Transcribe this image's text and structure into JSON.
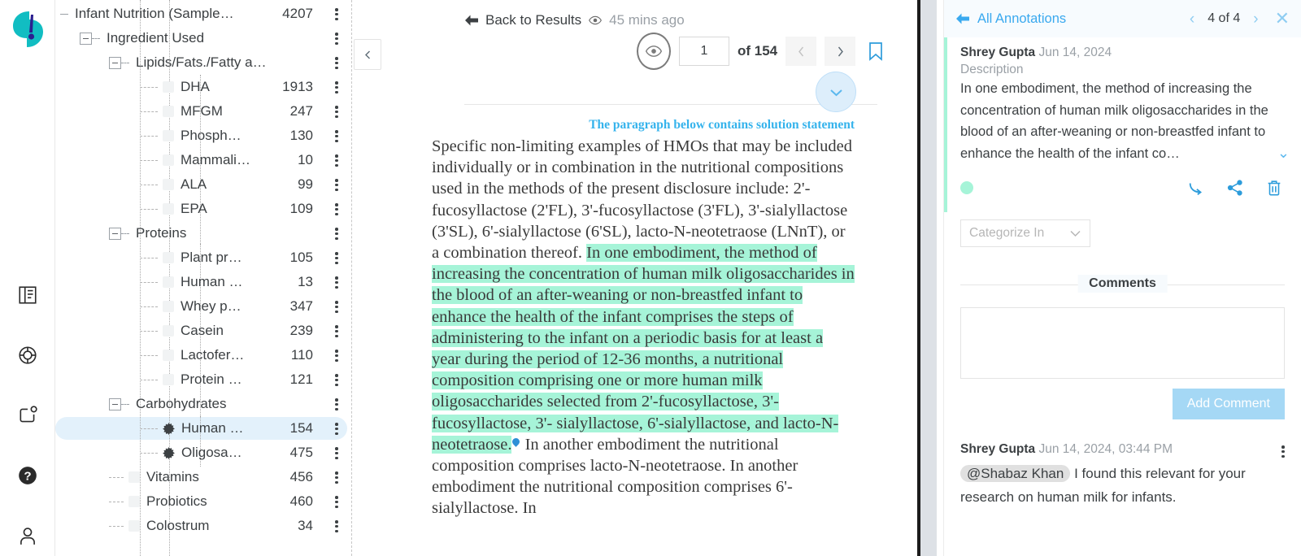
{
  "brand": {
    "logo_name": "app-logo",
    "teal": "#11bdc2",
    "navy": "#2b1f8f"
  },
  "rail": {
    "items": [
      {
        "name": "library-icon",
        "label": "Library"
      },
      {
        "name": "target-icon",
        "label": "Insights"
      },
      {
        "name": "notifications-icon",
        "label": "Alerts"
      },
      {
        "name": "help-icon",
        "label": "Help"
      },
      {
        "name": "user-icon",
        "label": "Account"
      }
    ]
  },
  "tree": {
    "rows": [
      {
        "label": "Infant Nutrition (Sample…",
        "count": "4207",
        "depth": 0,
        "type": "root",
        "expanded": true,
        "selected": false
      },
      {
        "label": "Ingredient Used",
        "count": "",
        "depth": 1,
        "type": "branch",
        "expanded": true,
        "selected": false
      },
      {
        "label": "Lipids/Fats./Fatty a…",
        "count": "",
        "depth": 2,
        "type": "branch",
        "expanded": true,
        "selected": false
      },
      {
        "label": "DHA",
        "count": "1913",
        "depth": 3,
        "type": "leaf",
        "selected": false
      },
      {
        "label": "MFGM",
        "count": "247",
        "depth": 3,
        "type": "leaf",
        "selected": false
      },
      {
        "label": "Phosph…",
        "count": "130",
        "depth": 3,
        "type": "leaf",
        "selected": false
      },
      {
        "label": "Mammali…",
        "count": "10",
        "depth": 3,
        "type": "leaf",
        "selected": false
      },
      {
        "label": "ALA",
        "count": "99",
        "depth": 3,
        "type": "leaf",
        "selected": false
      },
      {
        "label": "EPA",
        "count": "109",
        "depth": 3,
        "type": "leaf",
        "selected": false
      },
      {
        "label": "Proteins",
        "count": "",
        "depth": 2,
        "type": "branch",
        "expanded": true,
        "selected": false
      },
      {
        "label": "Plant pr…",
        "count": "105",
        "depth": 3,
        "type": "leaf",
        "selected": false
      },
      {
        "label": "Human …",
        "count": "13",
        "depth": 3,
        "type": "leaf",
        "selected": false
      },
      {
        "label": "Whey p…",
        "count": "347",
        "depth": 3,
        "type": "leaf",
        "selected": false
      },
      {
        "label": "Casein",
        "count": "239",
        "depth": 3,
        "type": "leaf",
        "selected": false
      },
      {
        "label": "Lactofer…",
        "count": "110",
        "depth": 3,
        "type": "leaf",
        "selected": false
      },
      {
        "label": "Protein …",
        "count": "121",
        "depth": 3,
        "type": "leaf",
        "selected": false
      },
      {
        "label": "Carbohydrates",
        "count": "",
        "depth": 2,
        "type": "branch",
        "expanded": true,
        "selected": false
      },
      {
        "label": "Human …",
        "count": "154",
        "depth": 3,
        "type": "burst",
        "selected": true
      },
      {
        "label": "Oligosa…",
        "count": "475",
        "depth": 3,
        "type": "burst",
        "selected": false
      },
      {
        "label": "Vitamins",
        "count": "456",
        "depth": 2,
        "type": "leaf2",
        "selected": false
      },
      {
        "label": "Probiotics",
        "count": "460",
        "depth": 2,
        "type": "leaf2",
        "selected": false
      },
      {
        "label": "Colostrum",
        "count": "34",
        "depth": 2,
        "type": "leaf2",
        "selected": false
      }
    ]
  },
  "doc": {
    "back_label": "Back to Results",
    "viewed_ago": "45 mins ago",
    "page_value": "1",
    "page_total": "of 154",
    "solution_note": "The paragraph below contains solution statement",
    "para_pre": "Specific non-limiting examples of HMOs that may be included individually or in combination in the nutritional compositions used in the methods of the present disclosure include: 2'-fucosyllactose (2'FL), 3'-fucosyllactose (3'FL), 3'-sialyllactose (3'SL), 6'-sialyllactose (6'SL), lacto-N-neotetraose (LNnT), or a combination thereof. ",
    "para_highlight": "In one embodiment, the method of increasing the concentration of human milk oligosaccharides in the blood of an after-weaning or non-breastfed infant to enhance the health of the infant comprises the steps of administering to the infant on a periodic basis for at least a year during the period of 12-36 months, a nutritional composition comprising one or more human milk oligosaccharides selected from 2'-fucosyllactose, 3'-fucosyllactose, 3'- sialyllactose, 6'-sialyllactose, and lacto-N-neotetraose.",
    "para_post": " In another embodiment the nutritional composition comprises lacto-N-neotetraose. In another embodiment the nutritional composition comprises 6'-sialyllactose. In"
  },
  "annotations": {
    "header": {
      "back_label": "All Annotations",
      "counter": "4 of 4"
    },
    "card": {
      "author": "Shrey Gupta",
      "date": "Jun 14, 2024",
      "field_label": "Description",
      "description": "In one embodiment, the method of increasing the concentration of human milk oligosaccharides in the blood of an after-weaning or non-breastfed infant to enhance the health of the infant co…",
      "categorize_label": "Categorize In"
    },
    "comments": {
      "section_label": "Comments",
      "add_button": "Add Comment",
      "items": [
        {
          "author": "Shrey Gupta",
          "date": "Jun 14, 2024, 03:44 PM",
          "mention": "@Shabaz Khan",
          "text": " I found this relevant for your research on human milk for infants."
        }
      ]
    }
  }
}
